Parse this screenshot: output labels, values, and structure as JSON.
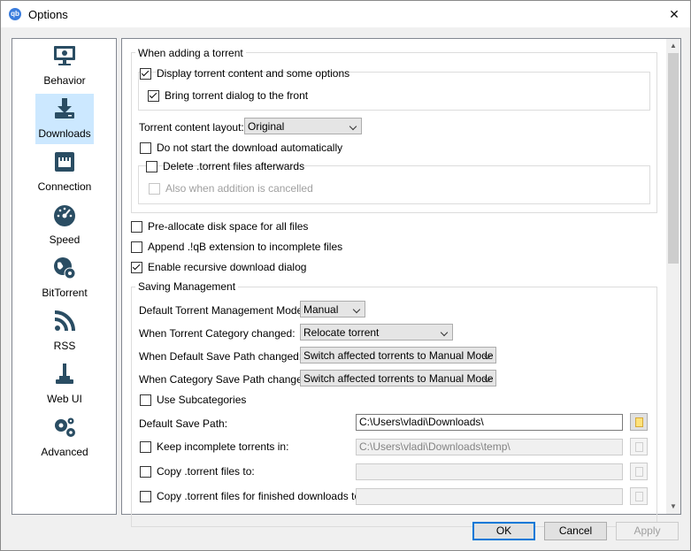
{
  "window": {
    "title": "Options",
    "app_icon": "qbittorrent-logo-icon",
    "close": "✕"
  },
  "sidebar": {
    "items": [
      {
        "label": "Behavior",
        "icon": "monitor-icon",
        "selected": false
      },
      {
        "label": "Downloads",
        "icon": "download-icon",
        "selected": true
      },
      {
        "label": "Connection",
        "icon": "network-port-icon",
        "selected": false
      },
      {
        "label": "Speed",
        "icon": "speedometer-icon",
        "selected": false
      },
      {
        "label": "BitTorrent",
        "icon": "globe-gear-icon",
        "selected": false
      },
      {
        "label": "RSS",
        "icon": "rss-icon",
        "selected": false
      },
      {
        "label": "Web UI",
        "icon": "joystick-icon",
        "selected": false
      },
      {
        "label": "Advanced",
        "icon": "gears-icon",
        "selected": false
      }
    ]
  },
  "adding": {
    "title": "When adding a torrent",
    "display_content": {
      "label": "Display torrent content and some options",
      "checked": true
    },
    "bring_front": {
      "label": "Bring torrent dialog to the front",
      "checked": true
    },
    "layout_label": "Torrent content layout:",
    "layout_value": "Original",
    "dont_start": {
      "label": "Do not start the download automatically",
      "checked": false
    },
    "delete_torrent": {
      "label": "Delete .torrent files afterwards",
      "checked": false
    },
    "also_cancelled": {
      "label": "Also when addition is cancelled",
      "checked": false,
      "disabled": true
    }
  },
  "general": {
    "preallocate": {
      "label": "Pre-allocate disk space for all files",
      "checked": false
    },
    "append_ext": {
      "label": "Append .!qB extension to incomplete files",
      "checked": false
    },
    "recursive": {
      "label": "Enable recursive download dialog",
      "checked": true
    }
  },
  "saving": {
    "title": "Saving Management",
    "mode_label": "Default Torrent Management Mode:",
    "mode_value": "Manual",
    "category_label": "When Torrent Category changed:",
    "category_value": "Relocate torrent",
    "default_path_changed_label": "When Default Save Path changed:",
    "default_path_changed_value": "Switch affected torrents to Manual Mode",
    "category_path_changed_label": "When Category Save Path changed:",
    "category_path_changed_value": "Switch affected torrents to Manual Mode",
    "subcategories": {
      "label": "Use Subcategories",
      "checked": false
    },
    "default_save_path_label": "Default Save Path:",
    "default_save_path_value": "C:\\Users\\vladi\\Downloads\\",
    "keep_incomplete": {
      "label": "Keep incomplete torrents in:",
      "checked": false
    },
    "keep_incomplete_value": "C:\\Users\\vladi\\Downloads\\temp\\",
    "copy_torrent": {
      "label": "Copy .torrent files to:",
      "checked": false
    },
    "copy_torrent_value": "",
    "copy_finished": {
      "label": "Copy .torrent files for finished downloads to:",
      "checked": false
    },
    "copy_finished_value": ""
  },
  "buttons": {
    "ok": "OK",
    "cancel": "Cancel",
    "apply": "Apply"
  },
  "colors": {
    "selection": "#cce8ff",
    "accent": "#0078d7",
    "folder": "#ffe27a"
  }
}
